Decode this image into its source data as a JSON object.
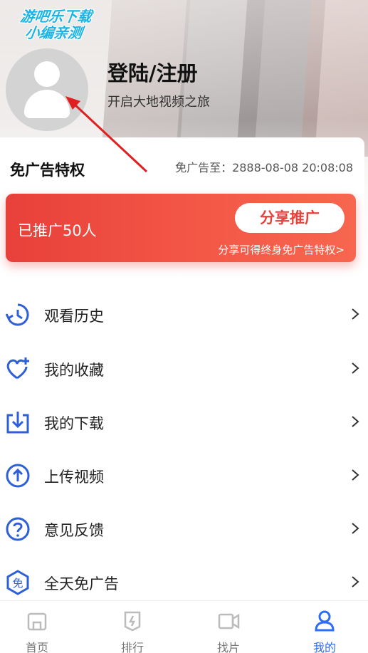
{
  "watermark": {
    "line1": "游吧乐下载",
    "line2": "小编亲测"
  },
  "profile": {
    "title": "登陆/注册",
    "subtitle": "开启大地视频之旅"
  },
  "ad_card": {
    "title": "免广告特权",
    "expire_text": "免广告至：2888-08-08 20:08:08",
    "promoted_count": "已推广50人",
    "share_button": "分享推广",
    "share_hint": "分享可得终身免广告特权>"
  },
  "menu": [
    {
      "label": "观看历史",
      "icon": "history-icon"
    },
    {
      "label": "我的收藏",
      "icon": "favorite-heart-icon"
    },
    {
      "label": "我的下载",
      "icon": "download-icon"
    },
    {
      "label": "上传视频",
      "icon": "upload-icon"
    },
    {
      "label": "意见反馈",
      "icon": "feedback-question-icon"
    },
    {
      "label": "全天免广告",
      "icon": "ad-free-icon"
    }
  ],
  "tabs": [
    {
      "label": "首页",
      "icon": "home-icon",
      "active": false
    },
    {
      "label": "排行",
      "icon": "ranking-icon",
      "active": false
    },
    {
      "label": "找片",
      "icon": "video-camera-icon",
      "active": false
    },
    {
      "label": "我的",
      "icon": "profile-icon",
      "active": true
    }
  ],
  "colors": {
    "accent": "#2d6cf6",
    "promo_red": "#e8403a",
    "annotation_arrow": "#e02020"
  }
}
